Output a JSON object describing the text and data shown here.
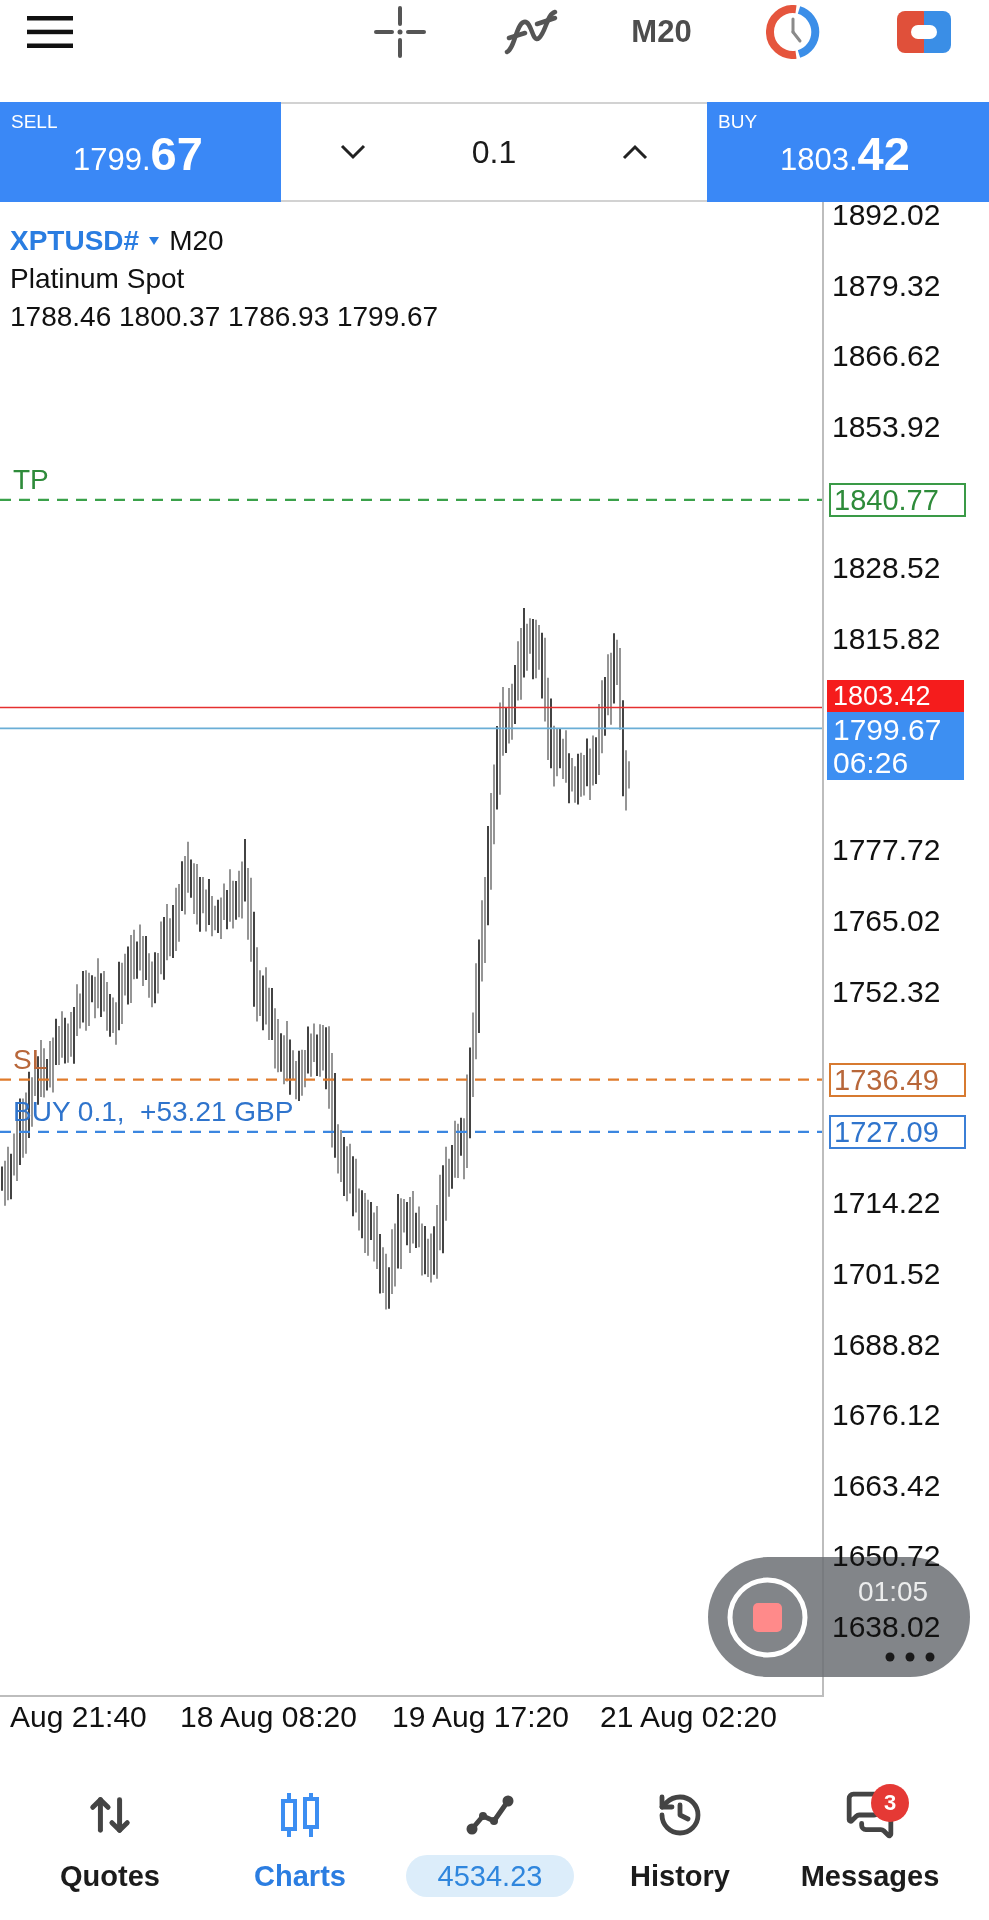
{
  "toolbar": {
    "timeframe": "M20"
  },
  "trade_panel": {
    "sell": {
      "label": "SELL",
      "price": "1799.67"
    },
    "volume": "0.1",
    "buy": {
      "label": "BUY",
      "price": "1803.42"
    }
  },
  "chart": {
    "symbol": "XPTUSD#",
    "timeframe": "M20",
    "description": "Platinum Spot",
    "ohlc": "1788.46 1800.37 1786.93 1799.67",
    "price_axis": [
      "1892.02",
      "1879.32",
      "1866.62",
      "1853.92",
      "1828.52",
      "1815.82",
      "1777.72",
      "1765.02",
      "1752.32",
      "1714.22",
      "1701.52",
      "1688.82",
      "1676.12",
      "1663.42",
      "1650.72",
      "1638.02"
    ],
    "levels": [
      {
        "kind": "take_profit",
        "label": "TP",
        "price": "1840.77"
      },
      {
        "kind": "stop_loss",
        "label": "SL",
        "price": "1736.49"
      },
      {
        "kind": "position",
        "label": "BUY 0.1,  +53.21 GBP",
        "price": "1727.09"
      }
    ],
    "ask_price": "1803.42",
    "bid": {
      "price": "1799.67",
      "countdown": "06:26"
    },
    "time_axis": [
      "Aug 21:40",
      "18 Aug 08:20",
      "19 Aug 17:20",
      "21 Aug 02:20"
    ]
  },
  "screen_recorder": {
    "elapsed": "01:05"
  },
  "bottom_nav": [
    {
      "kind": "tab",
      "label": "Quotes",
      "selected": false
    },
    {
      "kind": "tab",
      "label": "Charts",
      "selected": true
    },
    {
      "kind": "balance",
      "label": "4534.23",
      "selected": false
    },
    {
      "kind": "tab",
      "label": "History",
      "selected": false
    },
    {
      "kind": "tab",
      "label": "Messages",
      "selected": false,
      "badge": "3"
    }
  ]
}
